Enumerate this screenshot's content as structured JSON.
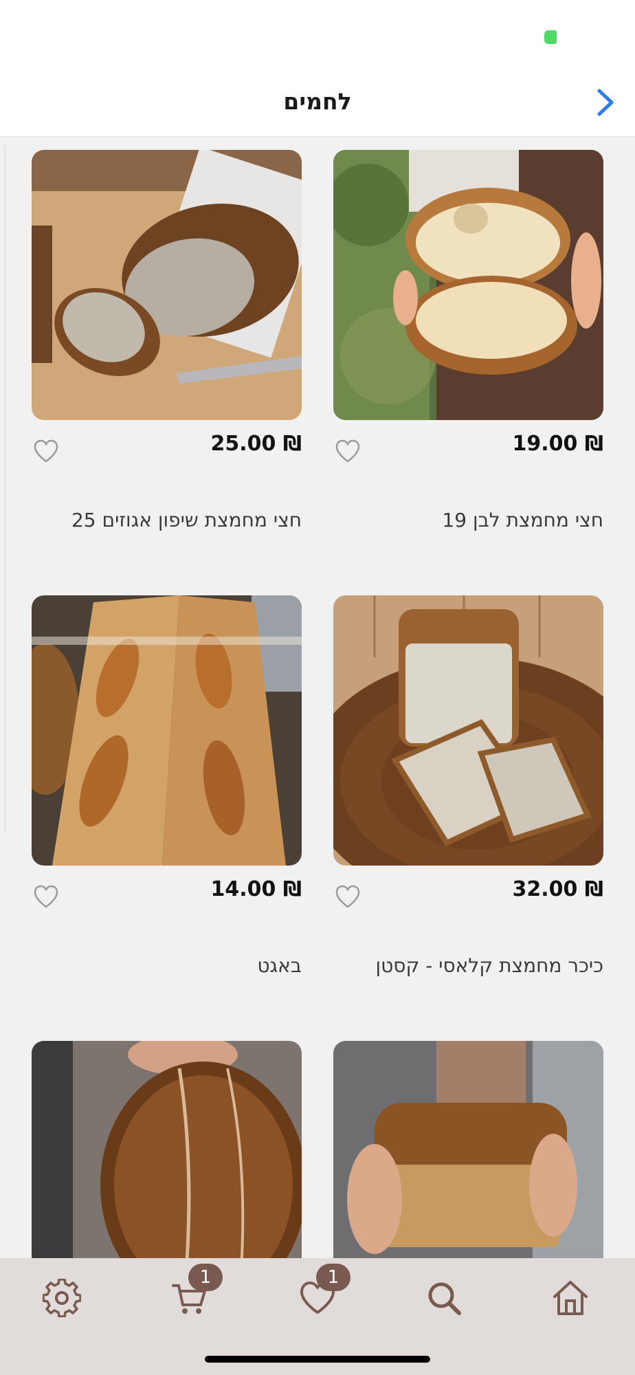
{
  "header": {
    "title": "לחמים",
    "back_icon": "chevron-right-icon"
  },
  "colors": {
    "accent": "#2f7ce8",
    "tab_icon": "#7a5a50",
    "tab_bar_bg": "#e1dcd9",
    "status_green": "#4cd964"
  },
  "products": [
    {
      "name": "חצי מחמצת לבן 19",
      "price": "₪ 19.00",
      "image": "bread-loaf-held-halves"
    },
    {
      "name": "חצי מחמצת שיפון אגוזים 25",
      "price": "₪ 25.00",
      "image": "sliced-rye-loaf-on-paper"
    },
    {
      "name": "כיכר מחמצת קלאסי - קסטן",
      "price": "₪ 32.00",
      "image": "sliced-tin-loaf-on-wood"
    },
    {
      "name": "באגט",
      "price": "₪ 14.00",
      "image": "baguettes"
    },
    {
      "name": "",
      "price": "",
      "image": "tin-loaf-held"
    },
    {
      "name": "",
      "price": "",
      "image": "round-loaf-held"
    }
  ],
  "tabbar": {
    "items": [
      {
        "icon": "home-icon"
      },
      {
        "icon": "search-icon"
      },
      {
        "icon": "heart-icon",
        "badge": "1"
      },
      {
        "icon": "cart-icon",
        "badge": "1"
      },
      {
        "icon": "gear-icon"
      }
    ]
  }
}
